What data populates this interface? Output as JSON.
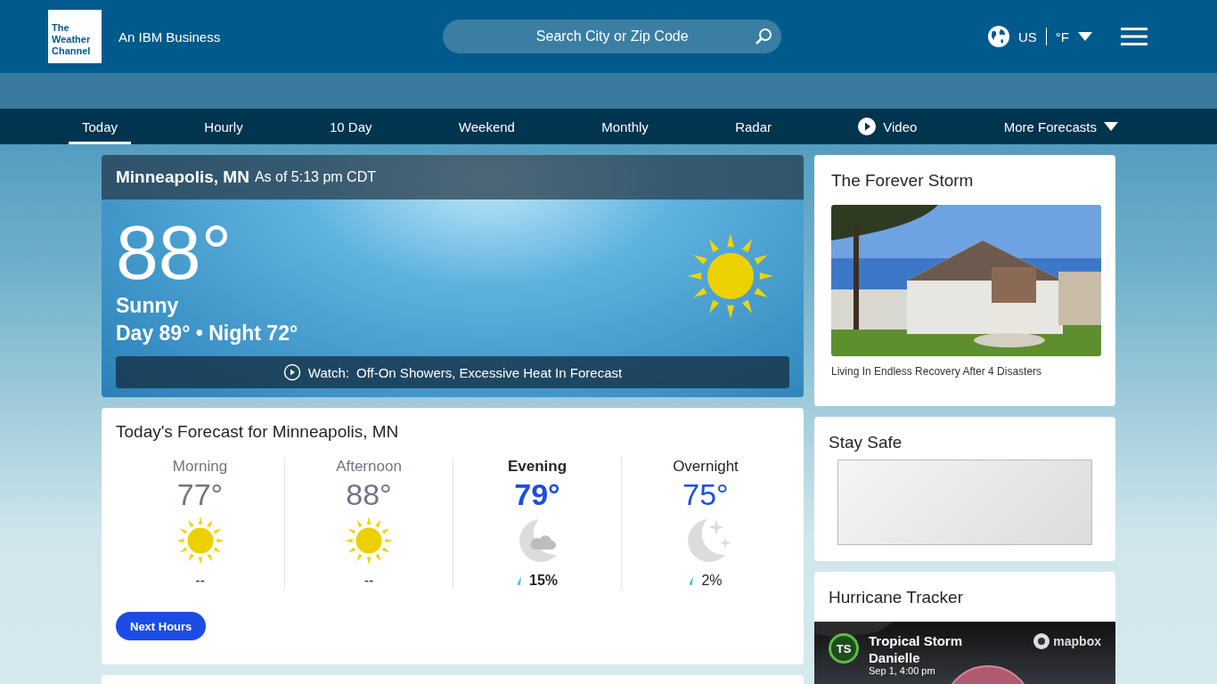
{
  "header": {
    "logo": [
      "The",
      "Weather",
      "Channel"
    ],
    "tagline": "An IBM Business",
    "search": {
      "placeholder": "Search City or Zip Code"
    },
    "locale": {
      "region": "US",
      "unit": "°F"
    }
  },
  "nav": [
    {
      "label": "Today",
      "selected": true,
      "kind": "text"
    },
    {
      "label": "Hourly",
      "selected": false,
      "kind": "text"
    },
    {
      "label": "10 Day",
      "selected": false,
      "kind": "text"
    },
    {
      "label": "Weekend",
      "selected": false,
      "kind": "text"
    },
    {
      "label": "Monthly",
      "selected": false,
      "kind": "text"
    },
    {
      "label": "Radar",
      "selected": false,
      "kind": "text"
    },
    {
      "label": "Video",
      "selected": false,
      "kind": "video"
    },
    {
      "label": "More Forecasts",
      "selected": false,
      "kind": "dropdown"
    }
  ],
  "current": {
    "location": "Minneapolis, MN",
    "as_of": "As of 5:13 pm CDT",
    "temperature": "88°",
    "condition": "Sunny",
    "day_night": "Day 89° • Night 72°",
    "watch_label": "Watch:",
    "watch_title": "Off-On Showers, Excessive Heat In Forecast"
  },
  "today_forecast": {
    "title": "Today's Forecast for Minneapolis, MN",
    "periods": [
      {
        "name": "Morning",
        "temp": "77°",
        "kind": "sun",
        "precip": "--",
        "selected": false,
        "past": true
      },
      {
        "name": "Afternoon",
        "temp": "88°",
        "kind": "sun",
        "precip": "--",
        "selected": false,
        "past": true
      },
      {
        "name": "Evening",
        "temp": "79°",
        "kind": "moon-cloud",
        "precip": "15%",
        "selected": true,
        "past": false
      },
      {
        "name": "Overnight",
        "temp": "75°",
        "kind": "moon-stars",
        "precip": "2%",
        "selected": false,
        "past": false
      }
    ],
    "button": "Next Hours"
  },
  "sidebar": [
    {
      "kind": "story",
      "title": "The Forever Storm",
      "caption": "Living In Endless Recovery After 4 Disasters"
    },
    {
      "kind": "ad",
      "title": "Stay Safe"
    },
    {
      "kind": "tracker",
      "title": "Hurricane Tracker",
      "badge": "TS",
      "storm": "Tropical Storm Danielle",
      "time": "Sep 1, 4:00 pm",
      "attribution": "mapbox"
    }
  ]
}
